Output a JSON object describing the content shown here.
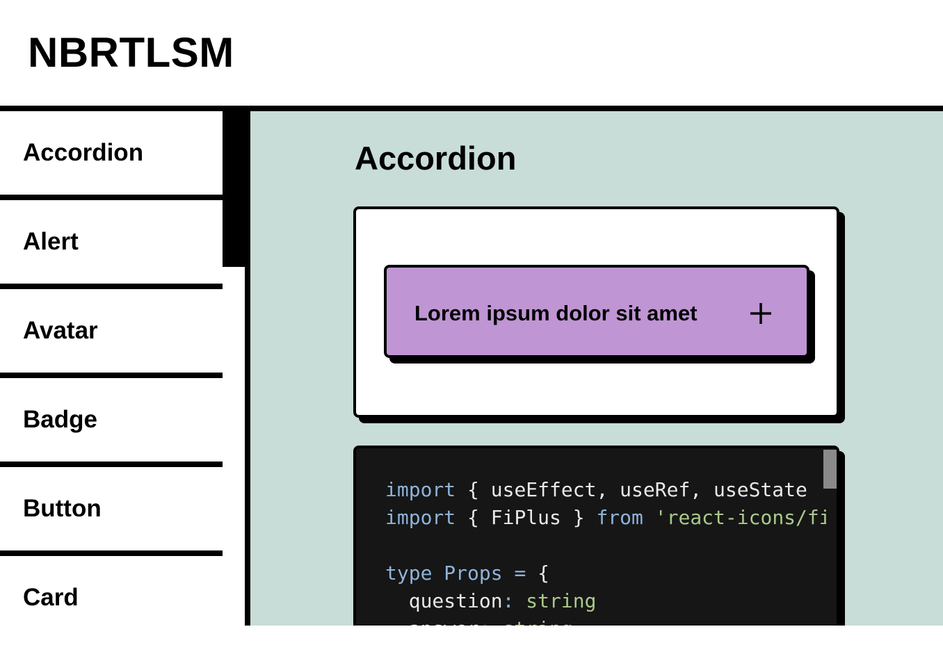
{
  "app": {
    "logo": "NBRTLSM"
  },
  "sidebar": {
    "items": [
      {
        "label": "Accordion",
        "active": true
      },
      {
        "label": "Alert"
      },
      {
        "label": "Avatar"
      },
      {
        "label": "Badge"
      },
      {
        "label": "Button"
      },
      {
        "label": "Card"
      }
    ]
  },
  "main": {
    "title": "Accordion",
    "preview": {
      "question": "Lorem ipsum dolor sit amet",
      "toggle_icon": "plus-icon"
    },
    "code": {
      "line1": {
        "kw": "import",
        "text": " { useEffect, useRef, useState"
      },
      "line2": {
        "kw": "import",
        "text": " { FiPlus } ",
        "kw2": "from",
        "space": " ",
        "str": "'react-icons/fi'"
      },
      "line4": {
        "kw": "type",
        "space": " ",
        "type": "Props",
        "op": " = ",
        "punct": "{"
      },
      "line5": {
        "indent": "  ",
        "prop": "question",
        "colon": ": ",
        "type": "string"
      },
      "line6": {
        "indent": "  ",
        "prop": "answer",
        "colon": ": ",
        "type": "string"
      }
    }
  },
  "colors": {
    "main_bg": "#c8dcd8",
    "accordion_bg": "#bf95d4",
    "code_bg": "#161616",
    "border": "#000000"
  }
}
